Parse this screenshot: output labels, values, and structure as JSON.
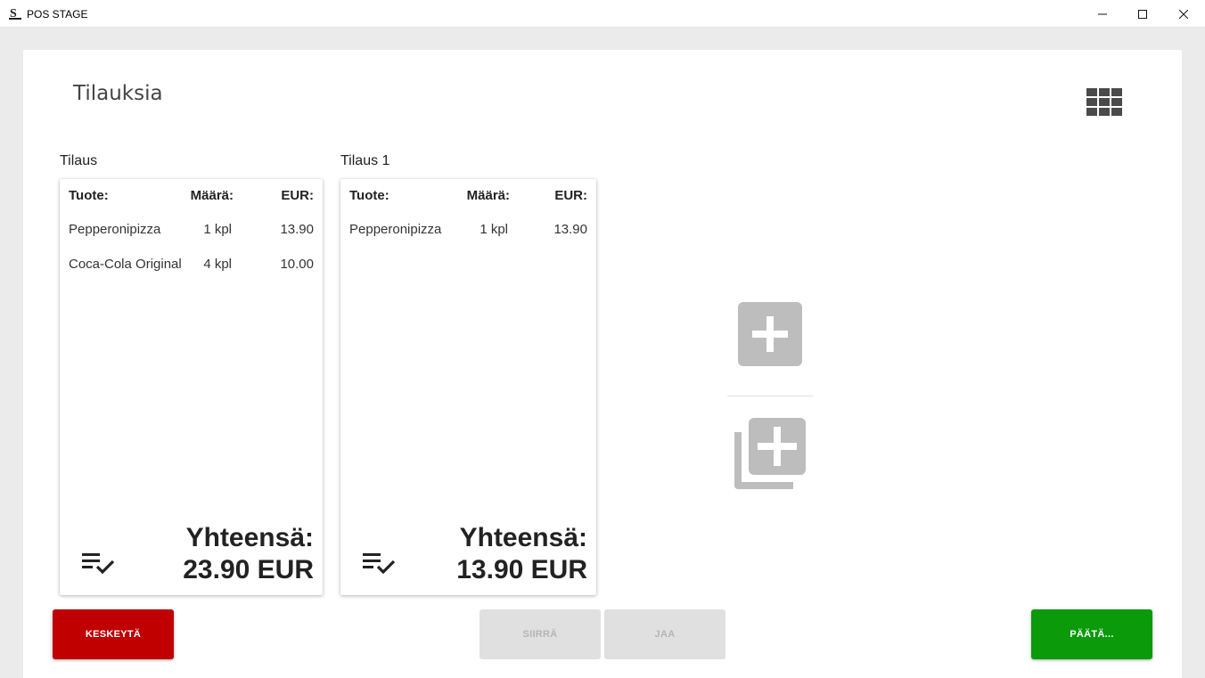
{
  "window": {
    "title": "POS STAGE"
  },
  "page": {
    "title": "Tilauksia"
  },
  "orders": [
    {
      "label": "Tilaus",
      "headers": {
        "product": "Tuote:",
        "quantity": "Määrä:",
        "eur": "EUR:"
      },
      "items": [
        {
          "product": "Pepperonipizza",
          "quantity": "1 kpl",
          "eur": "13.90"
        },
        {
          "product": "Coca-Cola Original",
          "quantity": "4 kpl",
          "eur": "10.00"
        }
      ],
      "total_label": "Yhteensä:",
      "total_value": "23.90 EUR"
    },
    {
      "label": "Tilaus 1",
      "headers": {
        "product": "Tuote:",
        "quantity": "Määrä:",
        "eur": "EUR:"
      },
      "items": [
        {
          "product": "Pepperonipizza",
          "quantity": "1 kpl",
          "eur": "13.90"
        }
      ],
      "total_label": "Yhteensä:",
      "total_value": "13.90 EUR"
    }
  ],
  "actions": {
    "cancel": "KESKEYTÄ",
    "move": "SIIRRÄ",
    "split": "JAA",
    "finish": "PÄÄTÄ..."
  },
  "icons": {
    "grid_view": "grid-view-icon",
    "checklist": "playlist-check-icon",
    "add": "add-box-icon",
    "add_copy": "library-add-icon"
  },
  "colors": {
    "cancel": "#c00000",
    "finish": "#0a9a0a",
    "disabled": "#e0e0e0",
    "add_button": "#bdbdbd"
  }
}
